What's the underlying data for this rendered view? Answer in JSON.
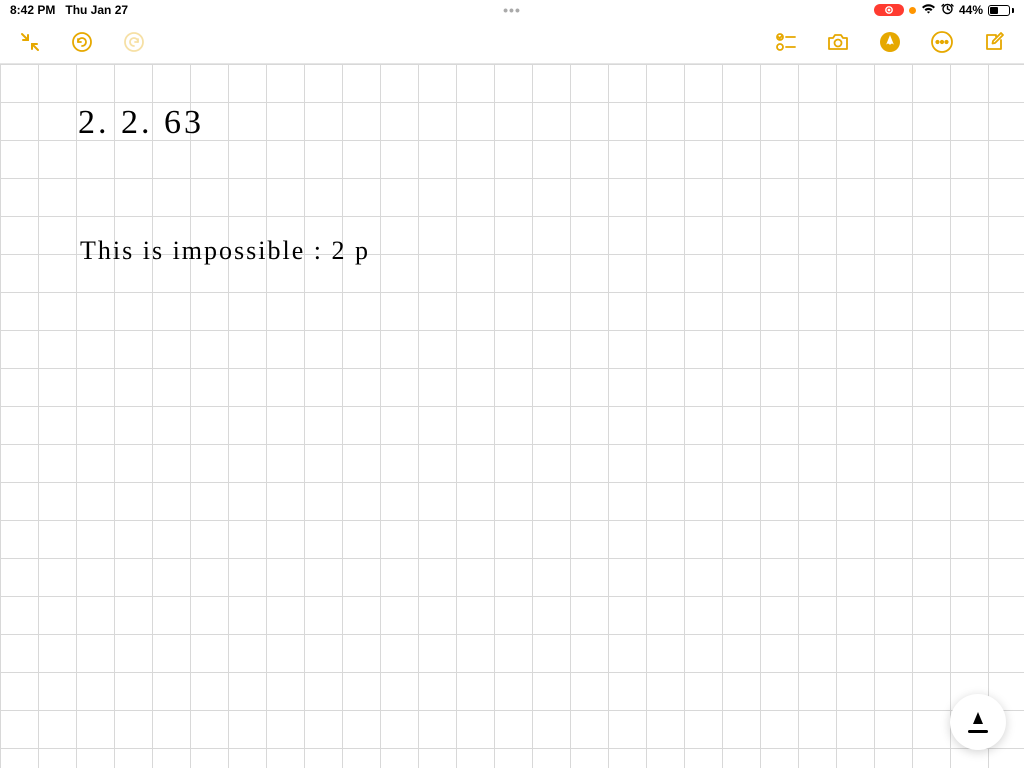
{
  "status_bar": {
    "time": "8:42 PM",
    "date": "Thu Jan 27",
    "multitasking_dots": "•••",
    "battery_percent": "44%"
  },
  "toolbar": {
    "collapse_icon": "collapse",
    "undo_icon": "undo",
    "redo_icon": "redo",
    "checklist_icon": "checklist",
    "camera_icon": "camera",
    "markup_icon": "markup",
    "more_icon": "more",
    "compose_icon": "compose"
  },
  "handwriting": {
    "title": "2. 2. 63",
    "line1": "This  is   impossible :  2  p"
  },
  "pencil_widget": {
    "icon": "apple-pencil"
  }
}
